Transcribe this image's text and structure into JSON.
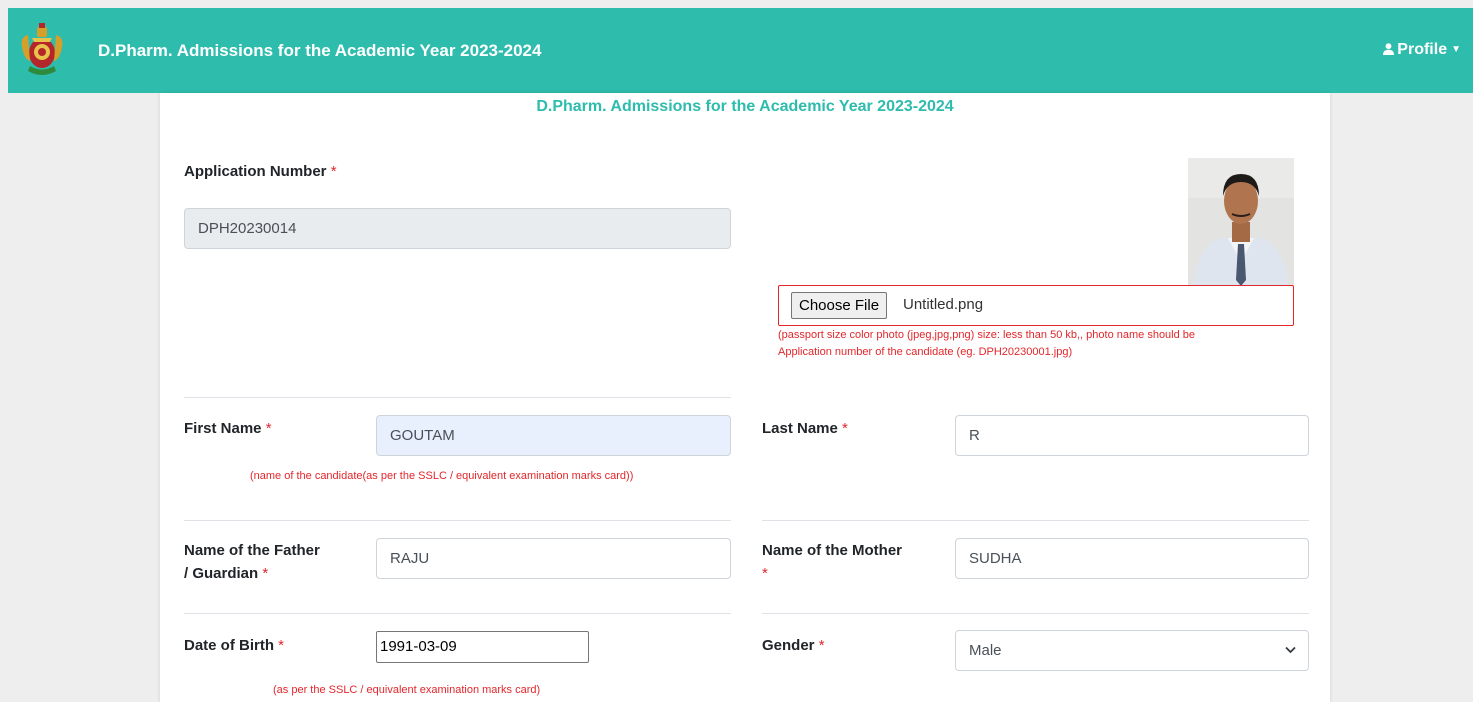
{
  "header": {
    "title": "D.Pharm. Admissions for the Academic Year 2023-2024",
    "profile_label": "Profile",
    "profile_icon": "user-icon",
    "dropdown_icon": "caret-down-icon",
    "brand_color": "#2ebcad"
  },
  "form": {
    "title": "D.Pharm. Admissions for the Academic Year 2023-2024",
    "required_mark": "*",
    "application_number": {
      "label": "Application Number",
      "value": "DPH20230014"
    },
    "photo": {
      "button_label": "Choose File",
      "file_name": "Untitled.png",
      "hint_line1": "(passport size color photo (jpeg,jpg,png) size: less than 50 kb,, photo name should be",
      "hint_line2": "Application number of the candidate (eg. DPH20230001.jpg)"
    },
    "first_name": {
      "label": "First Name",
      "value": "GOUTAM",
      "hint": "(name of the candidate(as per the SSLC / equivalent examination marks card))"
    },
    "last_name": {
      "label": "Last Name",
      "value": "R"
    },
    "father_name": {
      "label_line1": "Name of the Father",
      "label_line2": "/ Guardian",
      "value": "RAJU"
    },
    "mother_name": {
      "label": "Name of the Mother",
      "value": "SUDHA"
    },
    "dob": {
      "label": "Date of Birth",
      "value": "1991-03-09",
      "hint": "(as per the SSLC / equivalent examination marks card)"
    },
    "gender": {
      "label": "Gender",
      "value": "Male"
    }
  },
  "colors": {
    "accent": "#2ebcad",
    "error": "#e3262b"
  }
}
